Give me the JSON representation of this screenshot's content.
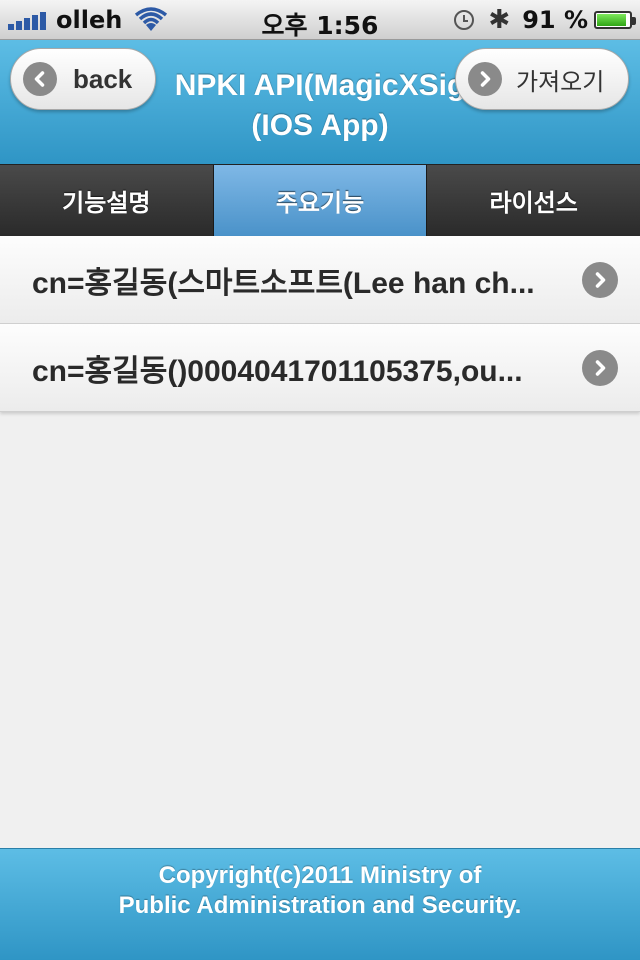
{
  "status_bar": {
    "carrier": "olleh",
    "time": "오후 1:56",
    "battery_percent": "91 %",
    "battery_level": 0.91,
    "icons": [
      "signal-bars-icon",
      "wifi-icon",
      "clock-icon",
      "bluetooth-icon",
      "battery-icon"
    ]
  },
  "header": {
    "title_line1": "NPKI API(MagicXSig",
    "title_line2": "(IOS App)",
    "back_label": "back",
    "get_label": "가져오기"
  },
  "tabs": [
    {
      "label": "기능설명",
      "active": false
    },
    {
      "label": "주요기능",
      "active": true
    },
    {
      "label": "라이선스",
      "active": false
    }
  ],
  "list": [
    {
      "label": "cn=홍길동(스마트소프트(Lee han ch..."
    },
    {
      "label": "cn=홍길동()0004041701105375,ou..."
    }
  ],
  "footer": {
    "line1": "Copyright(c)2011 Ministry of",
    "line2": "Public Administration and Security."
  },
  "colors": {
    "header_blue": "#3aa6d4",
    "tab_active": "#5fa3d8",
    "tab_dark": "#333333"
  }
}
